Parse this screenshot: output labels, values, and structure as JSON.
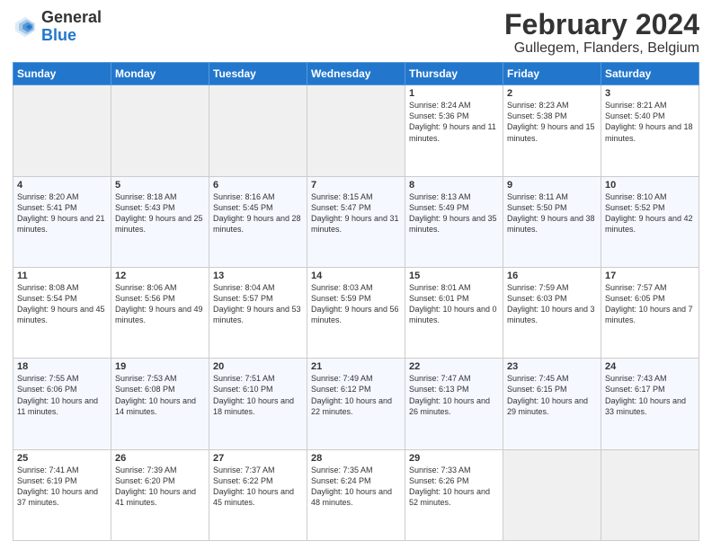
{
  "logo": {
    "general": "General",
    "blue": "Blue"
  },
  "header": {
    "month": "February 2024",
    "location": "Gullegem, Flanders, Belgium"
  },
  "weekdays": [
    "Sunday",
    "Monday",
    "Tuesday",
    "Wednesday",
    "Thursday",
    "Friday",
    "Saturday"
  ],
  "weeks": [
    [
      {
        "day": "",
        "info": ""
      },
      {
        "day": "",
        "info": ""
      },
      {
        "day": "",
        "info": ""
      },
      {
        "day": "",
        "info": ""
      },
      {
        "day": "1",
        "info": "Sunrise: 8:24 AM\nSunset: 5:36 PM\nDaylight: 9 hours\nand 11 minutes."
      },
      {
        "day": "2",
        "info": "Sunrise: 8:23 AM\nSunset: 5:38 PM\nDaylight: 9 hours\nand 15 minutes."
      },
      {
        "day": "3",
        "info": "Sunrise: 8:21 AM\nSunset: 5:40 PM\nDaylight: 9 hours\nand 18 minutes."
      }
    ],
    [
      {
        "day": "4",
        "info": "Sunrise: 8:20 AM\nSunset: 5:41 PM\nDaylight: 9 hours\nand 21 minutes."
      },
      {
        "day": "5",
        "info": "Sunrise: 8:18 AM\nSunset: 5:43 PM\nDaylight: 9 hours\nand 25 minutes."
      },
      {
        "day": "6",
        "info": "Sunrise: 8:16 AM\nSunset: 5:45 PM\nDaylight: 9 hours\nand 28 minutes."
      },
      {
        "day": "7",
        "info": "Sunrise: 8:15 AM\nSunset: 5:47 PM\nDaylight: 9 hours\nand 31 minutes."
      },
      {
        "day": "8",
        "info": "Sunrise: 8:13 AM\nSunset: 5:49 PM\nDaylight: 9 hours\nand 35 minutes."
      },
      {
        "day": "9",
        "info": "Sunrise: 8:11 AM\nSunset: 5:50 PM\nDaylight: 9 hours\nand 38 minutes."
      },
      {
        "day": "10",
        "info": "Sunrise: 8:10 AM\nSunset: 5:52 PM\nDaylight: 9 hours\nand 42 minutes."
      }
    ],
    [
      {
        "day": "11",
        "info": "Sunrise: 8:08 AM\nSunset: 5:54 PM\nDaylight: 9 hours\nand 45 minutes."
      },
      {
        "day": "12",
        "info": "Sunrise: 8:06 AM\nSunset: 5:56 PM\nDaylight: 9 hours\nand 49 minutes."
      },
      {
        "day": "13",
        "info": "Sunrise: 8:04 AM\nSunset: 5:57 PM\nDaylight: 9 hours\nand 53 minutes."
      },
      {
        "day": "14",
        "info": "Sunrise: 8:03 AM\nSunset: 5:59 PM\nDaylight: 9 hours\nand 56 minutes."
      },
      {
        "day": "15",
        "info": "Sunrise: 8:01 AM\nSunset: 6:01 PM\nDaylight: 10 hours\nand 0 minutes."
      },
      {
        "day": "16",
        "info": "Sunrise: 7:59 AM\nSunset: 6:03 PM\nDaylight: 10 hours\nand 3 minutes."
      },
      {
        "day": "17",
        "info": "Sunrise: 7:57 AM\nSunset: 6:05 PM\nDaylight: 10 hours\nand 7 minutes."
      }
    ],
    [
      {
        "day": "18",
        "info": "Sunrise: 7:55 AM\nSunset: 6:06 PM\nDaylight: 10 hours\nand 11 minutes."
      },
      {
        "day": "19",
        "info": "Sunrise: 7:53 AM\nSunset: 6:08 PM\nDaylight: 10 hours\nand 14 minutes."
      },
      {
        "day": "20",
        "info": "Sunrise: 7:51 AM\nSunset: 6:10 PM\nDaylight: 10 hours\nand 18 minutes."
      },
      {
        "day": "21",
        "info": "Sunrise: 7:49 AM\nSunset: 6:12 PM\nDaylight: 10 hours\nand 22 minutes."
      },
      {
        "day": "22",
        "info": "Sunrise: 7:47 AM\nSunset: 6:13 PM\nDaylight: 10 hours\nand 26 minutes."
      },
      {
        "day": "23",
        "info": "Sunrise: 7:45 AM\nSunset: 6:15 PM\nDaylight: 10 hours\nand 29 minutes."
      },
      {
        "day": "24",
        "info": "Sunrise: 7:43 AM\nSunset: 6:17 PM\nDaylight: 10 hours\nand 33 minutes."
      }
    ],
    [
      {
        "day": "25",
        "info": "Sunrise: 7:41 AM\nSunset: 6:19 PM\nDaylight: 10 hours\nand 37 minutes."
      },
      {
        "day": "26",
        "info": "Sunrise: 7:39 AM\nSunset: 6:20 PM\nDaylight: 10 hours\nand 41 minutes."
      },
      {
        "day": "27",
        "info": "Sunrise: 7:37 AM\nSunset: 6:22 PM\nDaylight: 10 hours\nand 45 minutes."
      },
      {
        "day": "28",
        "info": "Sunrise: 7:35 AM\nSunset: 6:24 PM\nDaylight: 10 hours\nand 48 minutes."
      },
      {
        "day": "29",
        "info": "Sunrise: 7:33 AM\nSunset: 6:26 PM\nDaylight: 10 hours\nand 52 minutes."
      },
      {
        "day": "",
        "info": ""
      },
      {
        "day": "",
        "info": ""
      }
    ]
  ]
}
